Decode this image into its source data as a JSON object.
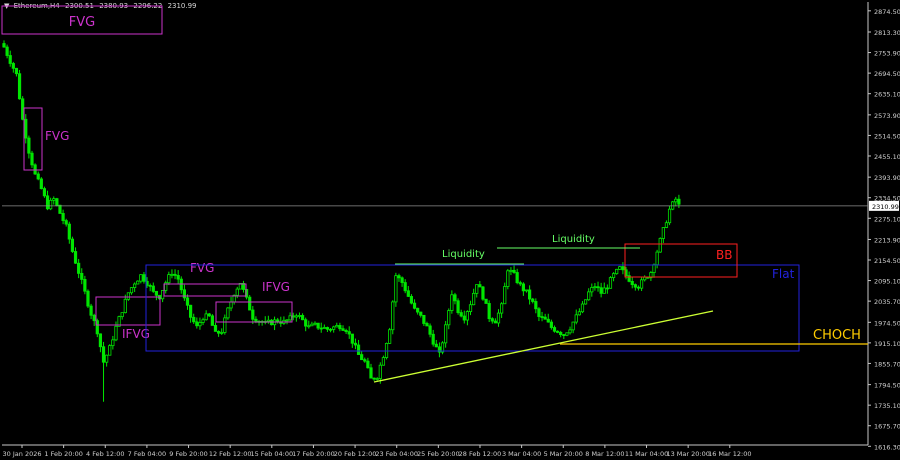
{
  "header": {
    "symbol": "Ethereum,H4",
    "o": "2300.51",
    "h": "2380.93",
    "l": "2296.22",
    "c": "2310.99"
  },
  "chart_data": {
    "type": "candlestick",
    "symbol": "Ethereum",
    "timeframe": "H4",
    "ylim": [
      1620,
      2900
    ],
    "y_ticks": [
      "2874.50",
      "2813.30",
      "2753.90",
      "2694.50",
      "2635.10",
      "2573.90",
      "2514.50",
      "2455.10",
      "2393.90",
      "2334.50",
      "2275.10",
      "2213.90",
      "2154.50",
      "2095.10",
      "2035.70",
      "1974.50",
      "1915.10",
      "1855.70",
      "1794.50",
      "1735.10",
      "1675.70",
      "1616.30"
    ],
    "x_ticks": [
      "30 Jan 2026",
      "1 Feb 20:00",
      "4 Feb 12:00",
      "7 Feb 04:00",
      "9 Feb 20:00",
      "12 Feb 12:00",
      "15 Feb 04:00",
      "17 Feb 20:00",
      "20 Feb 12:00",
      "23 Feb 04:00",
      "25 Feb 20:00",
      "28 Feb 12:00",
      "3 Mar 04:00",
      "5 Mar 20:00",
      "8 Mar 12:00",
      "11 Mar 04:00",
      "13 Mar 20:00",
      "16 Mar 12:00"
    ],
    "last_price": "2310.99",
    "close_path": [
      [
        0,
        2770
      ],
      [
        2,
        2730
      ],
      [
        4,
        2690
      ],
      [
        6,
        2560
      ],
      [
        8,
        2470
      ],
      [
        10,
        2400
      ],
      [
        12,
        2360
      ],
      [
        14,
        2310
      ],
      [
        16,
        2330
      ],
      [
        18,
        2290
      ],
      [
        20,
        2250
      ],
      [
        22,
        2180
      ],
      [
        24,
        2120
      ],
      [
        26,
        2060
      ],
      [
        28,
        2000
      ],
      [
        30,
        1950
      ],
      [
        32,
        1860
      ],
      [
        34,
        1900
      ],
      [
        36,
        1960
      ],
      [
        38,
        2010
      ],
      [
        40,
        2060
      ],
      [
        42,
        2090
      ],
      [
        44,
        2110
      ],
      [
        46,
        2090
      ],
      [
        48,
        2060
      ],
      [
        50,
        2050
      ],
      [
        52,
        2090
      ],
      [
        54,
        2120
      ],
      [
        56,
        2100
      ],
      [
        58,
        2040
      ],
      [
        60,
        1990
      ],
      [
        62,
        1960
      ],
      [
        64,
        1990
      ],
      [
        66,
        1990
      ],
      [
        68,
        1940
      ],
      [
        70,
        1950
      ],
      [
        72,
        2010
      ],
      [
        74,
        2060
      ],
      [
        76,
        2090
      ],
      [
        78,
        2040
      ],
      [
        80,
        1990
      ],
      [
        82,
        1980
      ],
      [
        84,
        1970
      ],
      [
        86,
        1975
      ],
      [
        88,
        1980
      ],
      [
        90,
        1975
      ],
      [
        92,
        1985
      ],
      [
        94,
        2000
      ],
      [
        96,
        1980
      ],
      [
        98,
        1960
      ],
      [
        100,
        1965
      ],
      [
        102,
        1960
      ],
      [
        104,
        1955
      ],
      [
        106,
        1960
      ],
      [
        108,
        1965
      ],
      [
        110,
        1955
      ],
      [
        112,
        1920
      ],
      [
        114,
        1880
      ],
      [
        116,
        1860
      ],
      [
        118,
        1810
      ],
      [
        120,
        1820
      ],
      [
        122,
        1880
      ],
      [
        124,
        1960
      ],
      [
        126,
        2110
      ],
      [
        128,
        2090
      ],
      [
        130,
        2050
      ],
      [
        132,
        2010
      ],
      [
        134,
        1990
      ],
      [
        136,
        1960
      ],
      [
        138,
        1920
      ],
      [
        140,
        1880
      ],
      [
        142,
        1960
      ],
      [
        144,
        2060
      ],
      [
        146,
        2010
      ],
      [
        148,
        1990
      ],
      [
        150,
        2030
      ],
      [
        152,
        2090
      ],
      [
        154,
        2050
      ],
      [
        156,
        1990
      ],
      [
        158,
        1980
      ],
      [
        160,
        2020
      ],
      [
        162,
        2130
      ],
      [
        164,
        2110
      ],
      [
        166,
        2080
      ],
      [
        168,
        2060
      ],
      [
        170,
        2030
      ],
      [
        172,
        1990
      ],
      [
        174,
        1980
      ],
      [
        176,
        1960
      ],
      [
        178,
        1950
      ],
      [
        180,
        1940
      ],
      [
        182,
        1960
      ],
      [
        184,
        1990
      ],
      [
        186,
        2020
      ],
      [
        188,
        2060
      ],
      [
        190,
        2080
      ],
      [
        192,
        2060
      ],
      [
        194,
        2080
      ],
      [
        196,
        2110
      ],
      [
        198,
        2130
      ],
      [
        200,
        2110
      ],
      [
        202,
        2090
      ],
      [
        204,
        2080
      ],
      [
        206,
        2100
      ],
      [
        208,
        2120
      ],
      [
        210,
        2180
      ],
      [
        212,
        2240
      ],
      [
        214,
        2300
      ],
      [
        216,
        2330
      ],
      [
        217,
        2311
      ]
    ],
    "annotations": {
      "fvg_labels": [
        "FVG",
        "FVG",
        "FVG"
      ],
      "ifvg_labels": [
        "IFVG",
        "IFVG"
      ],
      "liquidity_labels": [
        "Liquidity",
        "Liquidity"
      ],
      "bb_label": "BB",
      "flat_label": "Flat",
      "choch_label": "CHOCH"
    },
    "colors": {
      "background": "#000000",
      "candle": "#00e600",
      "fvg": "#cc33cc",
      "flat": "#2222dd",
      "bb": "#ff2020",
      "choch": "#ffcc00",
      "trendline": "#ccff33",
      "liquidity": "#66ff66",
      "axis_text": "#d0d0d0"
    }
  }
}
